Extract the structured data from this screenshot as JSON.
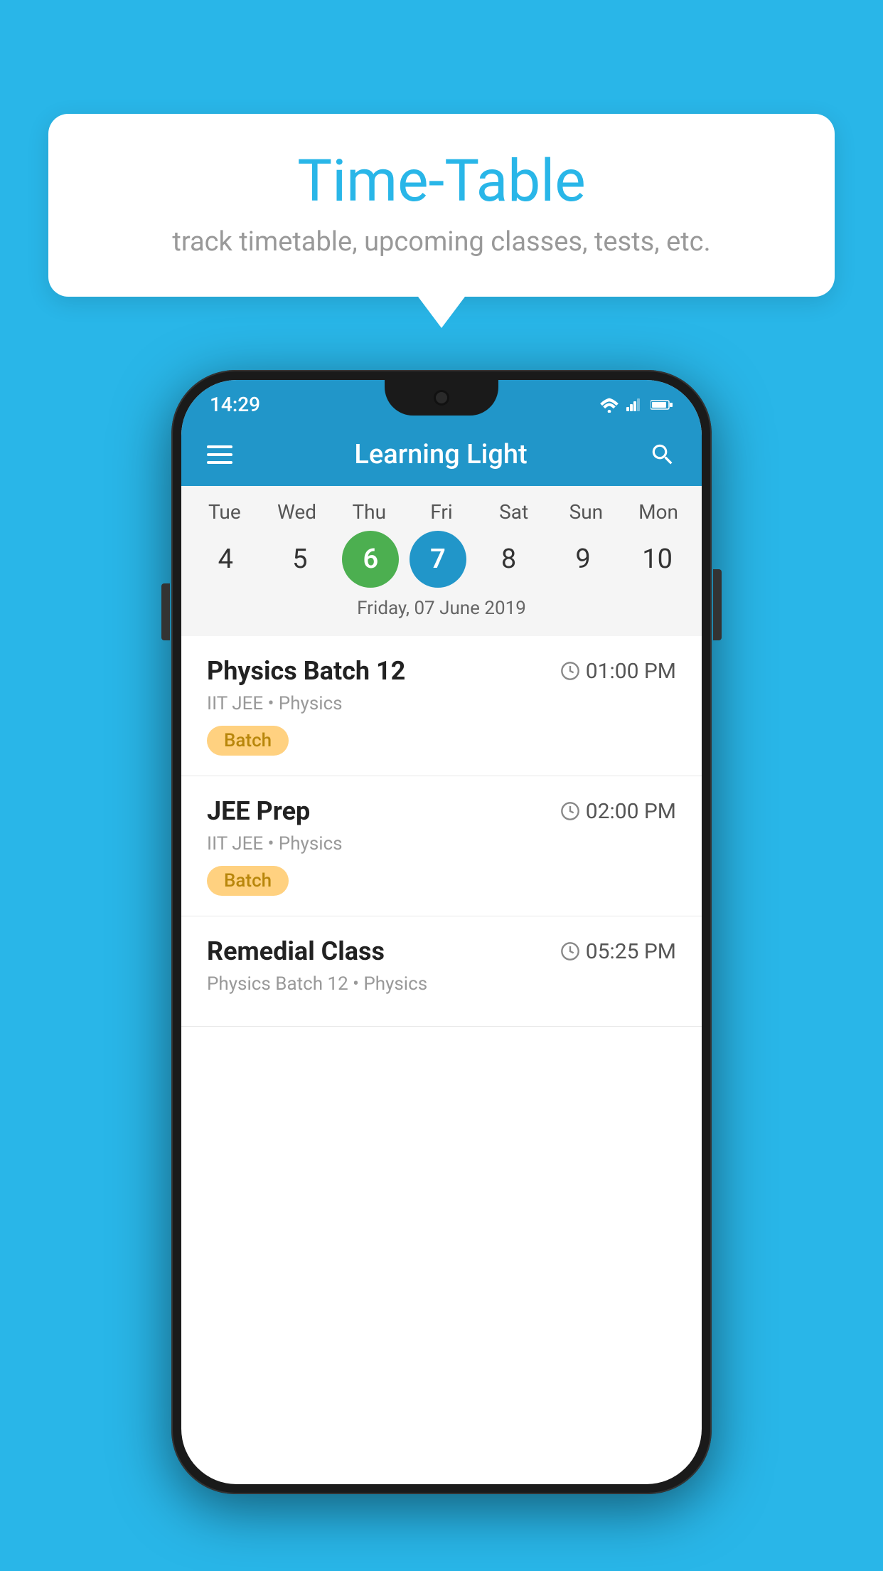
{
  "background_color": "#29b6e8",
  "tooltip": {
    "title": "Time-Table",
    "subtitle": "track timetable, upcoming classes, tests, etc."
  },
  "phone": {
    "status_bar": {
      "time": "14:29"
    },
    "app_bar": {
      "title": "Learning Light"
    },
    "calendar": {
      "days": [
        {
          "name": "Tue",
          "num": "4",
          "state": "normal"
        },
        {
          "name": "Wed",
          "num": "5",
          "state": "normal"
        },
        {
          "name": "Thu",
          "num": "6",
          "state": "today"
        },
        {
          "name": "Fri",
          "num": "7",
          "state": "selected"
        },
        {
          "name": "Sat",
          "num": "8",
          "state": "normal"
        },
        {
          "name": "Sun",
          "num": "9",
          "state": "normal"
        },
        {
          "name": "Mon",
          "num": "10",
          "state": "normal"
        }
      ],
      "selected_date_label": "Friday, 07 June 2019"
    },
    "schedule": [
      {
        "title": "Physics Batch 12",
        "time": "01:00 PM",
        "meta": "IIT JEE • Physics",
        "badge": "Batch"
      },
      {
        "title": "JEE Prep",
        "time": "02:00 PM",
        "meta": "IIT JEE • Physics",
        "badge": "Batch"
      },
      {
        "title": "Remedial Class",
        "time": "05:25 PM",
        "meta": "Physics Batch 12 • Physics",
        "badge": ""
      }
    ]
  }
}
